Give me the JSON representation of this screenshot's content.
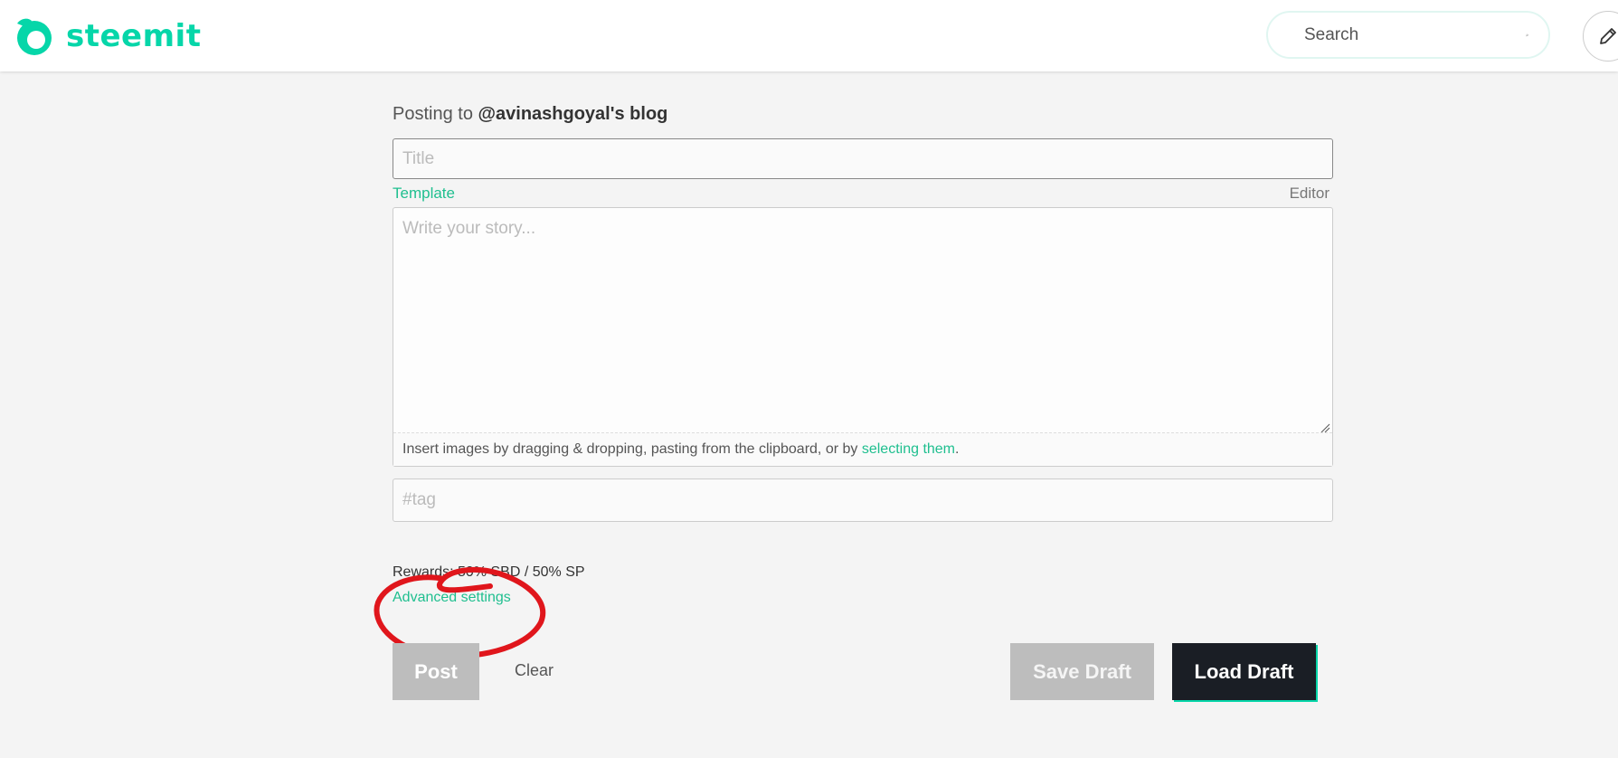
{
  "header": {
    "brand": "steemit",
    "search_placeholder": "Search",
    "icons": {
      "logo": "steemit-logo-icon",
      "search": "search-icon",
      "compose": "pencil-icon"
    }
  },
  "form": {
    "posting_to_prefix": "Posting to ",
    "posting_to_blog": "@avinashgoyal's blog",
    "title_placeholder": "Title",
    "template_label": "Template",
    "editor_label": "Editor",
    "story_placeholder": "Write your story...",
    "insert_text": "Insert images by dragging & dropping, pasting from the clipboard, or by ",
    "insert_link": "selecting them",
    "insert_period": ".",
    "tag_placeholder": "#tag",
    "rewards": "Rewards: 50% SBD / 50% SP",
    "advanced_settings": "Advanced settings"
  },
  "buttons": {
    "post": "Post",
    "clear": "Clear",
    "save_draft": "Save Draft",
    "load_draft": "Load Draft"
  },
  "colors": {
    "brand": "#06d6a9",
    "link": "#1fbf8f",
    "annotation": "#e0161c",
    "disabled_button": "#bdbdbd",
    "dark_button": "#1a1e25"
  }
}
